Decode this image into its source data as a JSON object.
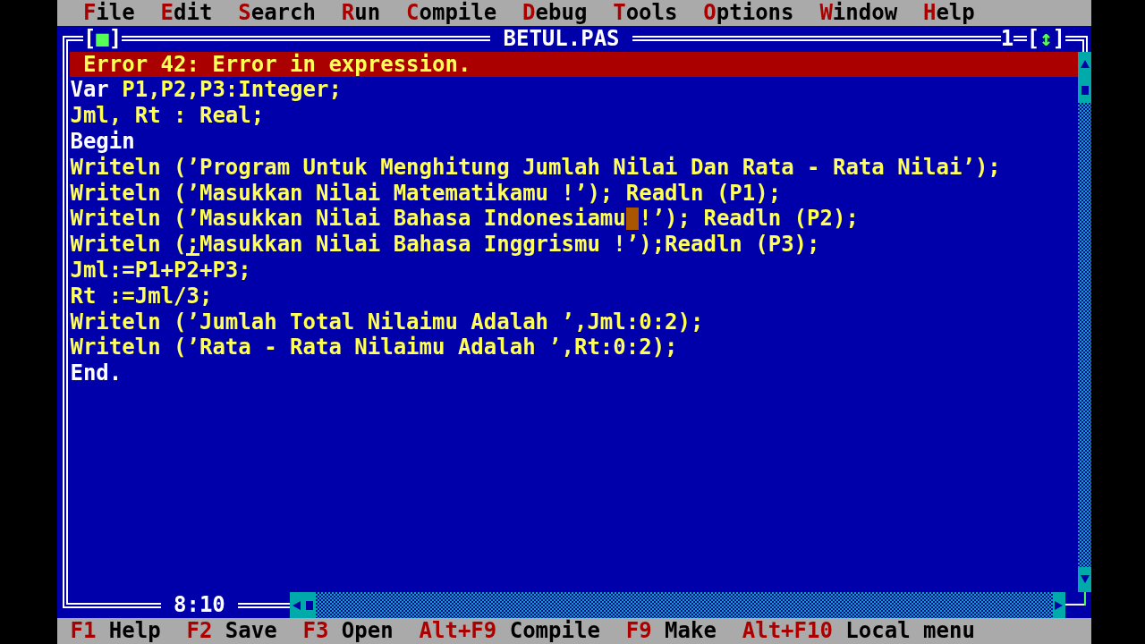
{
  "menu_bar": {
    "items": [
      {
        "hotkey": "F",
        "rest": "ile"
      },
      {
        "hotkey": "E",
        "rest": "dit"
      },
      {
        "hotkey": "S",
        "rest": "earch"
      },
      {
        "hotkey": "R",
        "rest": "un"
      },
      {
        "hotkey": "C",
        "rest": "ompile"
      },
      {
        "hotkey": "D",
        "rest": "ebug"
      },
      {
        "hotkey": "T",
        "rest": "ools"
      },
      {
        "hotkey": "O",
        "rest": "ptions"
      },
      {
        "hotkey": "W",
        "rest": "indow"
      },
      {
        "hotkey": "H",
        "rest": "elp"
      }
    ]
  },
  "window": {
    "close_button": {
      "left": "[",
      "glyph": "■",
      "right": "]"
    },
    "title": "BETUL.PAS",
    "number": "1",
    "zoom_button": {
      "left": "[",
      "glyph": "↕",
      "right": "]"
    },
    "error_message": "Error 42: Error in expression.",
    "lines": [
      {
        "segments": [
          {
            "kind": "reserved",
            "text": "Var"
          },
          {
            "kind": "plain",
            "text": " P1,P2,P3:Integer;"
          }
        ]
      },
      {
        "segments": [
          {
            "kind": "plain",
            "text": "Jml, Rt : Real;"
          }
        ]
      },
      {
        "segments": [
          {
            "kind": "reserved",
            "text": "Begin"
          }
        ]
      },
      {
        "segments": [
          {
            "kind": "plain",
            "text": "Writeln (’Program Untuk Menghitung Jumlah Nilai Dan Rata - Rata Nilai’);"
          }
        ]
      },
      {
        "segments": [
          {
            "kind": "plain",
            "text": "Writeln (’Masukkan Nilai Matematikamu !’); Readln (P1);"
          }
        ]
      },
      {
        "segments": [
          {
            "kind": "plain",
            "text": "Writeln (’Masukkan Nilai Bahasa Indonesiamu"
          },
          {
            "kind": "block_cursor"
          },
          {
            "kind": "plain",
            "text": "!’); Readln (P2);"
          }
        ]
      },
      {
        "segments": [
          {
            "kind": "plain",
            "text": "Writeln ("
          },
          {
            "kind": "underline_cursor",
            "text": ";"
          },
          {
            "kind": "plain",
            "text": "Masukkan Nilai Bahasa Inggrismu !’);Readln (P3);"
          }
        ]
      },
      {
        "segments": [
          {
            "kind": "plain",
            "text": "Jml:=P1+P2+P3;"
          }
        ]
      },
      {
        "segments": [
          {
            "kind": "plain",
            "text": "Rt :=Jml/3;"
          }
        ]
      },
      {
        "segments": [
          {
            "kind": "plain",
            "text": "Writeln (’Jumlah Total Nilaimu Adalah ’,Jml:0:2);"
          }
        ]
      },
      {
        "segments": [
          {
            "kind": "plain",
            "text": "Writeln (’Rata - Rata Nilaimu Adalah ’,Rt:0:2);"
          }
        ]
      },
      {
        "segments": [
          {
            "kind": "reserved",
            "text": "End."
          }
        ]
      }
    ],
    "cursor_position": "8:10"
  },
  "status_bar": {
    "items": [
      {
        "key": "F1",
        "label": "Help"
      },
      {
        "key": "F2",
        "label": "Save"
      },
      {
        "key": "F3",
        "label": "Open"
      },
      {
        "key": "Alt+F9",
        "label": "Compile"
      },
      {
        "key": "F9",
        "label": "Make"
      },
      {
        "key": "Alt+F10",
        "label": "Local menu"
      }
    ]
  }
}
